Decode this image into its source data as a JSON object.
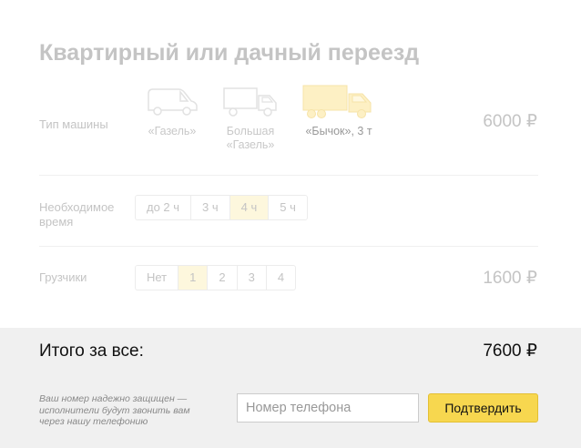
{
  "title": "Квартирный или дачный переезд",
  "vehicle": {
    "label": "Тип машины",
    "price": "6000 ₽",
    "options": [
      {
        "caption": "«Газель»",
        "icon": "van-icon",
        "selected": false
      },
      {
        "caption": "Большая\n«Газель»",
        "icon": "truck-icon",
        "selected": false
      },
      {
        "caption": "«Бычок», 3 т",
        "icon": "large-truck-icon",
        "selected": true
      }
    ],
    "selected_color": "#fdf0c4"
  },
  "time": {
    "label": "Необходимое\nвремя",
    "options": [
      "до 2 ч",
      "3 ч",
      "4 ч",
      "5 ч"
    ],
    "selected_index": 2
  },
  "movers": {
    "label": "Грузчики",
    "options": [
      "Нет",
      "1",
      "2",
      "3",
      "4"
    ],
    "selected_index": 1,
    "price": "1600 ₽"
  },
  "footer": {
    "total_label": "Итого за все:",
    "total_value": "7600 ₽",
    "privacy_note": "Ваш номер надежно защищен — исполнители будут звонить вам через нашу телефонию",
    "phone_placeholder": "Номер телефона",
    "confirm_label": "Подтвердить"
  },
  "colors": {
    "accent": "#f7d74f",
    "segment_active": "#fdf7dd",
    "footer_bg": "#f0f0f0"
  }
}
